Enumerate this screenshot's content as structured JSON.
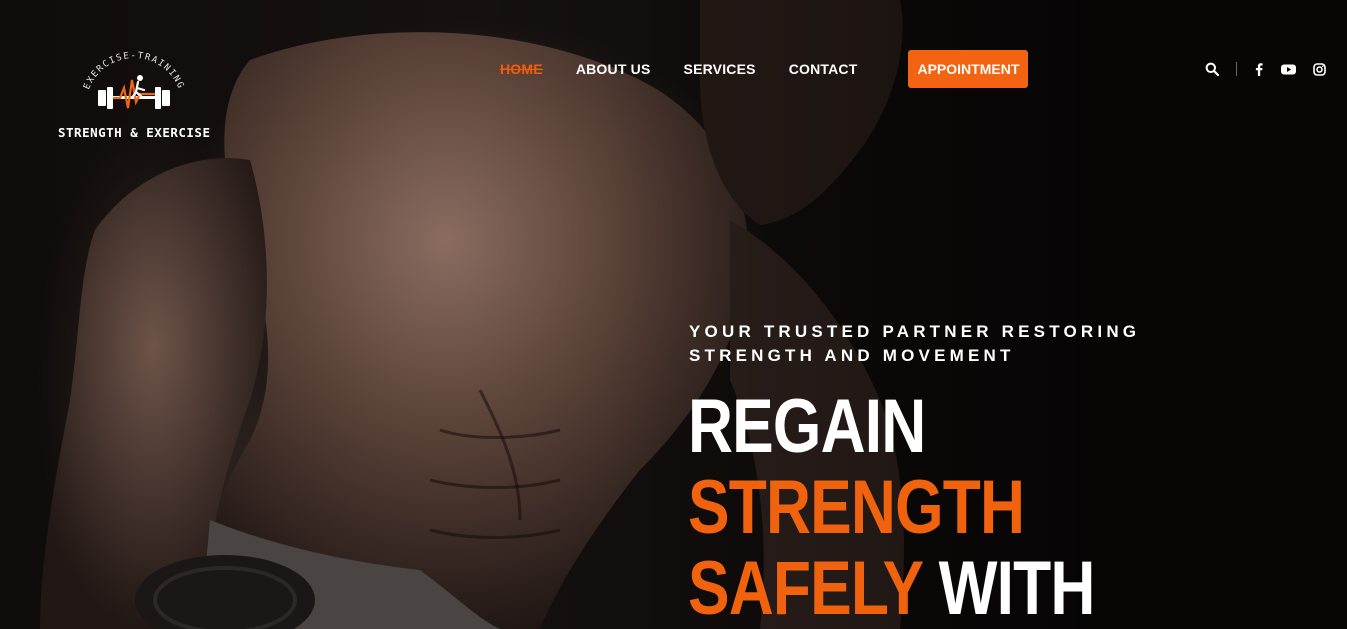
{
  "brand": {
    "logo_arc_text": "EXERCISE-TRAINING",
    "logo_name": "STRENGTH & EXERCISE",
    "accent_color": "#f26411"
  },
  "nav": {
    "items": [
      {
        "label": "HOME",
        "active": true
      },
      {
        "label": "ABOUT US",
        "active": false
      },
      {
        "label": "SERVICES",
        "active": false
      },
      {
        "label": "CONTACT",
        "active": false
      }
    ],
    "cta_label": "APPOINTMENT"
  },
  "header_icons": [
    "search-icon",
    "facebook-icon",
    "youtube-icon",
    "instagram-icon"
  ],
  "hero": {
    "tagline_line1": "YOUR TRUSTED PARTNER RESTORING",
    "tagline_line2": "STRENGTH AND MOVEMENT",
    "headline_line1": "REGAIN",
    "headline_line2": "STRENGTH",
    "headline_line3_orange": "SAFELY",
    "headline_line3_white": "WITH"
  }
}
